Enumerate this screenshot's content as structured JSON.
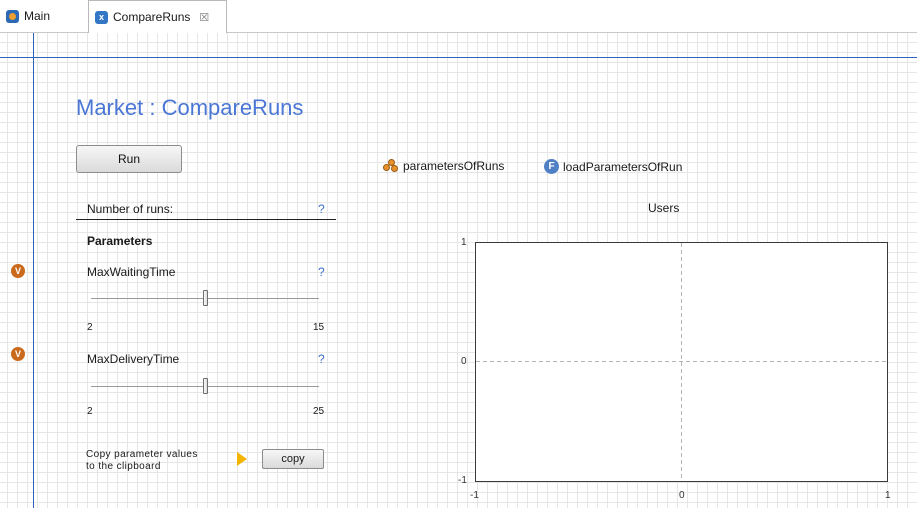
{
  "tabs": [
    {
      "label": "Main",
      "icon": "agent-icon"
    },
    {
      "label": "CompareRuns",
      "icon": "experiment-icon",
      "close": "☒"
    }
  ],
  "title": "Market : CompareRuns",
  "run_button": "Run",
  "legend": {
    "collection_label": "parametersOfRuns",
    "function_label": "loadParametersOfRun",
    "function_glyph": "F"
  },
  "number_of_runs": {
    "label": "Number of runs:",
    "help": "?"
  },
  "parameters_heading": "Parameters",
  "params": [
    {
      "name": "MaxWaitingTime",
      "help": "?",
      "min": "2",
      "max": "15",
      "value_fraction": 0.5,
      "badge": "V"
    },
    {
      "name": "MaxDeliveryTime",
      "help": "?",
      "min": "2",
      "max": "25",
      "value_fraction": 0.5,
      "badge": "V"
    }
  ],
  "copy": {
    "text_line1": "Copy parameter values",
    "text_line2": "to the clipboard",
    "button": "copy"
  },
  "chart_data": {
    "type": "line",
    "title": "Users",
    "xlabel": "",
    "ylabel": "",
    "xlim": [
      -1,
      1
    ],
    "ylim": [
      -1,
      1
    ],
    "x_ticks": [
      "-1",
      "0",
      "1"
    ],
    "y_ticks": [
      "1",
      "0",
      "-1"
    ],
    "series": [],
    "grid": "dashed center lines"
  }
}
